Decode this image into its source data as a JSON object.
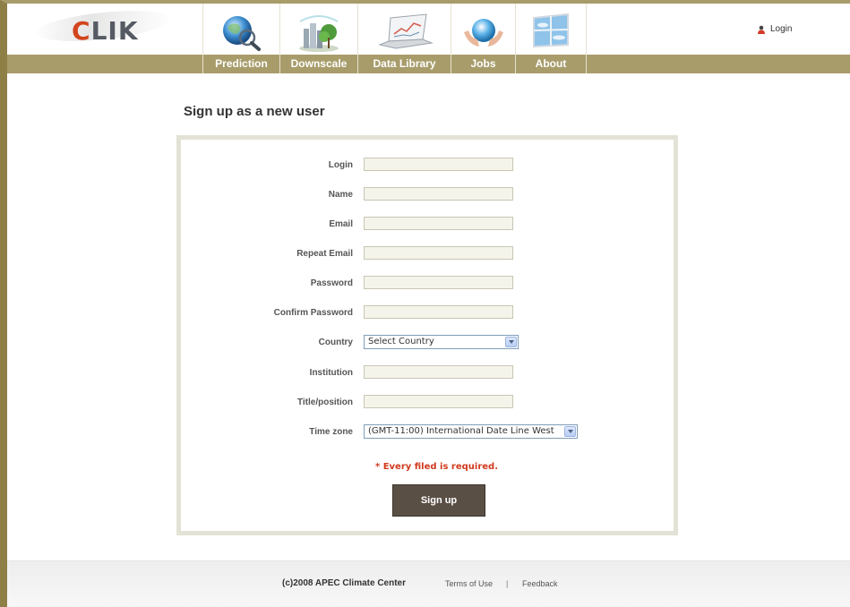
{
  "header": {
    "logo_text": "CLIK",
    "login_label": "Login"
  },
  "nav": [
    {
      "label": "Prediction",
      "icon": "globe-magnifier-icon"
    },
    {
      "label": "Downscale",
      "icon": "city-tree-icon"
    },
    {
      "label": "Data Library",
      "icon": "laptop-chart-icon"
    },
    {
      "label": "Jobs",
      "icon": "hands-globe-icon"
    },
    {
      "label": "About",
      "icon": "sky-window-icon"
    }
  ],
  "page": {
    "title": "Sign up as a new user"
  },
  "form": {
    "login_label": "Login",
    "name_label": "Name",
    "email_label": "Email",
    "repeat_email_label": "Repeat Email",
    "password_label": "Password",
    "confirm_password_label": "Confirm Password",
    "country_label": "Country",
    "country_value": "Select Country",
    "institution_label": "Institution",
    "title_label": "Title/position",
    "timezone_label": "Time zone",
    "timezone_value": "(GMT-11:00) International Date Line West",
    "required_note": "* Every filed is required.",
    "submit_label": "Sign up"
  },
  "footer": {
    "copyright": "(c)2008 APEC Climate Center",
    "terms_label": "Terms of Use",
    "separator": "|",
    "feedback_label": "Feedback"
  },
  "colors": {
    "brand_bar": "#a89c6b",
    "logo_accent": "#d2451e",
    "button": "#5a4f45",
    "required": "#d03a1c"
  }
}
